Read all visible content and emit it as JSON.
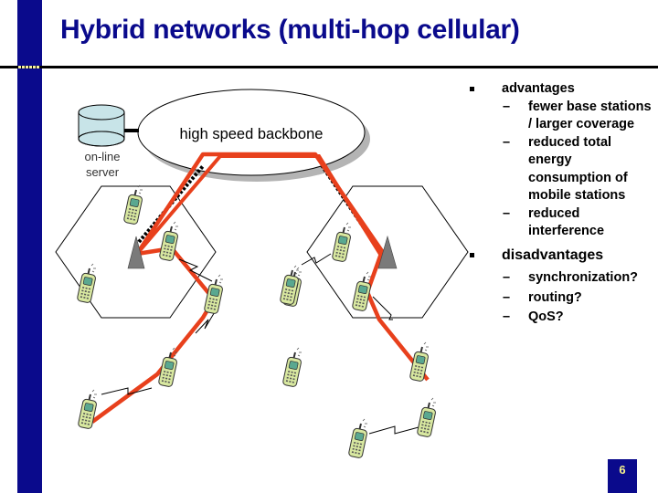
{
  "slide": {
    "title": "Hybrid networks (multi-hop cellular)",
    "page_number": "6",
    "colors": {
      "brand_blue": "#0a0a8c",
      "page_number_text": "#f5f08c",
      "route_red": "#e8401c",
      "phone_green": "#d8e8a0",
      "server_fill": "#c8e4e8",
      "base_station_gray": "#7a7a7a"
    }
  },
  "diagram": {
    "backbone_label": "high speed backbone",
    "server_label_line1": "on-line",
    "server_label_line2": "server",
    "icons": {
      "server": "database-cylinder-icon",
      "base_station": "antenna-triangle-icon",
      "mobile": "mobile-phone-icon",
      "link": "radio-link-zigzag-icon"
    }
  },
  "bullets": {
    "advantages": {
      "label": "advantages",
      "items": [
        "fewer base stations / larger coverage",
        "reduced total energy consumption of mobile stations",
        "reduced interference"
      ]
    },
    "disadvantages": {
      "label": "disadvantages",
      "items": [
        "synchronization?",
        "routing?",
        "QoS?"
      ]
    },
    "dash": "–"
  }
}
